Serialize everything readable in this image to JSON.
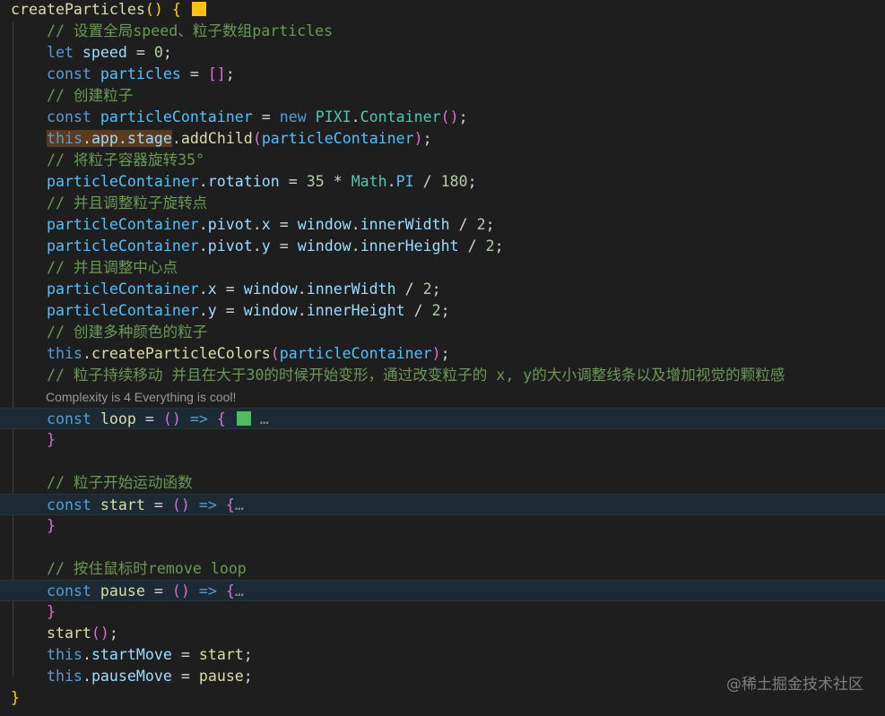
{
  "codelens": {
    "text": "Complexity is 4 Everything is cool!"
  },
  "watermark": "@稀土掘金技术社区",
  "colors": {
    "swatch_yellow": "#ffc20e",
    "swatch_green": "#4dbb5f"
  },
  "lines": [
    [
      {
        "t": "createParticles",
        "c": "fn"
      },
      {
        "t": "() ",
        "c": "br1"
      },
      {
        "t": "{",
        "c": "br1"
      },
      {
        "t": " ",
        "c": "plain"
      },
      {
        "t": "",
        "c": "swatch",
        "color": "swatch_yellow"
      }
    ],
    [
      {
        "t": "    // 设置全局speed、粒子数组particles",
        "c": "cmt"
      }
    ],
    [
      {
        "t": "    let",
        "c": "kw"
      },
      {
        "t": " speed",
        "c": "var"
      },
      {
        "t": " = ",
        "c": "op"
      },
      {
        "t": "0",
        "c": "num"
      },
      {
        "t": ";",
        "c": "op"
      }
    ],
    [
      {
        "t": "    const",
        "c": "kw"
      },
      {
        "t": " particles",
        "c": "cst"
      },
      {
        "t": " = ",
        "c": "op"
      },
      {
        "t": "[]",
        "c": "br2"
      },
      {
        "t": ";",
        "c": "op"
      }
    ],
    [
      {
        "t": "    // 创建粒子",
        "c": "cmt"
      }
    ],
    [
      {
        "t": "    const",
        "c": "kw"
      },
      {
        "t": " particleContainer",
        "c": "cst"
      },
      {
        "t": " = ",
        "c": "op"
      },
      {
        "t": "new",
        "c": "kw"
      },
      {
        "t": " PIXI",
        "c": "cls"
      },
      {
        "t": ".",
        "c": "op"
      },
      {
        "t": "Container",
        "c": "cls"
      },
      {
        "t": "()",
        "c": "br2"
      },
      {
        "t": ";",
        "c": "op"
      }
    ],
    [
      {
        "t": "    ",
        "c": "plain"
      },
      {
        "t": "this",
        "c": "kw",
        "hl": true
      },
      {
        "t": ".",
        "c": "op",
        "hl": true
      },
      {
        "t": "app",
        "c": "var",
        "hl": true
      },
      {
        "t": ".",
        "c": "op",
        "hl": true
      },
      {
        "t": "stage",
        "c": "var",
        "hl": true
      },
      {
        "t": ".",
        "c": "op"
      },
      {
        "t": "addChild",
        "c": "fn"
      },
      {
        "t": "(",
        "c": "br2"
      },
      {
        "t": "particleContainer",
        "c": "cst"
      },
      {
        "t": ")",
        "c": "br2"
      },
      {
        "t": ";",
        "c": "op"
      }
    ],
    [
      {
        "t": "    // 将粒子容器旋转35°",
        "c": "cmt"
      }
    ],
    [
      {
        "t": "    particleContainer",
        "c": "cst"
      },
      {
        "t": ".",
        "c": "op"
      },
      {
        "t": "rotation",
        "c": "var"
      },
      {
        "t": " = ",
        "c": "op"
      },
      {
        "t": "35",
        "c": "num"
      },
      {
        "t": " * ",
        "c": "op"
      },
      {
        "t": "Math",
        "c": "cls"
      },
      {
        "t": ".",
        "c": "op"
      },
      {
        "t": "PI",
        "c": "cst"
      },
      {
        "t": " / ",
        "c": "op"
      },
      {
        "t": "180",
        "c": "num"
      },
      {
        "t": ";",
        "c": "op"
      }
    ],
    [
      {
        "t": "    // 并且调整粒子旋转点",
        "c": "cmt"
      }
    ],
    [
      {
        "t": "    particleContainer",
        "c": "cst"
      },
      {
        "t": ".",
        "c": "op"
      },
      {
        "t": "pivot",
        "c": "var"
      },
      {
        "t": ".",
        "c": "op"
      },
      {
        "t": "x",
        "c": "var"
      },
      {
        "t": " = ",
        "c": "op"
      },
      {
        "t": "window",
        "c": "var"
      },
      {
        "t": ".",
        "c": "op"
      },
      {
        "t": "innerWidth",
        "c": "var"
      },
      {
        "t": " / ",
        "c": "op"
      },
      {
        "t": "2",
        "c": "num"
      },
      {
        "t": ";",
        "c": "op"
      }
    ],
    [
      {
        "t": "    particleContainer",
        "c": "cst"
      },
      {
        "t": ".",
        "c": "op"
      },
      {
        "t": "pivot",
        "c": "var"
      },
      {
        "t": ".",
        "c": "op"
      },
      {
        "t": "y",
        "c": "var"
      },
      {
        "t": " = ",
        "c": "op"
      },
      {
        "t": "window",
        "c": "var"
      },
      {
        "t": ".",
        "c": "op"
      },
      {
        "t": "innerHeight",
        "c": "var"
      },
      {
        "t": " / ",
        "c": "op"
      },
      {
        "t": "2",
        "c": "num"
      },
      {
        "t": ";",
        "c": "op"
      }
    ],
    [
      {
        "t": "    // 并且调整中心点",
        "c": "cmt"
      }
    ],
    [
      {
        "t": "    particleContainer",
        "c": "cst"
      },
      {
        "t": ".",
        "c": "op"
      },
      {
        "t": "x",
        "c": "var"
      },
      {
        "t": " = ",
        "c": "op"
      },
      {
        "t": "window",
        "c": "var"
      },
      {
        "t": ".",
        "c": "op"
      },
      {
        "t": "innerWidth",
        "c": "var"
      },
      {
        "t": " / ",
        "c": "op"
      },
      {
        "t": "2",
        "c": "num"
      },
      {
        "t": ";",
        "c": "op"
      }
    ],
    [
      {
        "t": "    particleContainer",
        "c": "cst"
      },
      {
        "t": ".",
        "c": "op"
      },
      {
        "t": "y",
        "c": "var"
      },
      {
        "t": " = ",
        "c": "op"
      },
      {
        "t": "window",
        "c": "var"
      },
      {
        "t": ".",
        "c": "op"
      },
      {
        "t": "innerHeight",
        "c": "var"
      },
      {
        "t": " / ",
        "c": "op"
      },
      {
        "t": "2",
        "c": "num"
      },
      {
        "t": ";",
        "c": "op"
      }
    ],
    [
      {
        "t": "    // 创建多种颜色的粒子",
        "c": "cmt"
      }
    ],
    [
      {
        "t": "    this",
        "c": "kw"
      },
      {
        "t": ".",
        "c": "op"
      },
      {
        "t": "createParticleColors",
        "c": "fn"
      },
      {
        "t": "(",
        "c": "br2"
      },
      {
        "t": "particleContainer",
        "c": "cst"
      },
      {
        "t": ")",
        "c": "br2"
      },
      {
        "t": ";",
        "c": "op"
      }
    ],
    [
      {
        "t": "    // 粒子持续移动 并且在大于30的时候开始变形，通过改变粒子的 x, y的大小调整线条以及增加视觉的颗粒感",
        "c": "cmt"
      }
    ],
    [],
    [
      {
        "t": "    const",
        "c": "kw"
      },
      {
        "t": " loop",
        "c": "fn"
      },
      {
        "t": " = ",
        "c": "op"
      },
      {
        "t": "()",
        "c": "br2"
      },
      {
        "t": " => ",
        "c": "kw"
      },
      {
        "t": "{",
        "c": "br2"
      },
      {
        "t": " ",
        "c": "plain"
      },
      {
        "t": "",
        "c": "swatch",
        "color": "swatch_green"
      },
      {
        "t": " …",
        "c": "dots"
      }
    ],
    [
      {
        "t": "    }",
        "c": "br2"
      }
    ],
    [],
    [
      {
        "t": "    // 粒子开始运动函数",
        "c": "cmt"
      }
    ],
    [
      {
        "t": "    const",
        "c": "kw"
      },
      {
        "t": " start",
        "c": "fn"
      },
      {
        "t": " = ",
        "c": "op"
      },
      {
        "t": "()",
        "c": "br2"
      },
      {
        "t": " => ",
        "c": "kw"
      },
      {
        "t": "{",
        "c": "br2"
      },
      {
        "t": "…",
        "c": "dots"
      }
    ],
    [
      {
        "t": "    }",
        "c": "br2"
      }
    ],
    [],
    [
      {
        "t": "    // 按住鼠标时remove loop",
        "c": "cmt"
      }
    ],
    [
      {
        "t": "    const",
        "c": "kw"
      },
      {
        "t": " pause",
        "c": "fn"
      },
      {
        "t": " = ",
        "c": "op"
      },
      {
        "t": "()",
        "c": "br2"
      },
      {
        "t": " => ",
        "c": "kw"
      },
      {
        "t": "{",
        "c": "br2"
      },
      {
        "t": "…",
        "c": "dots"
      }
    ],
    [
      {
        "t": "    }",
        "c": "br2"
      }
    ],
    [
      {
        "t": "    start",
        "c": "fn"
      },
      {
        "t": "()",
        "c": "br2"
      },
      {
        "t": ";",
        "c": "op"
      }
    ],
    [
      {
        "t": "    this",
        "c": "kw"
      },
      {
        "t": ".",
        "c": "op"
      },
      {
        "t": "startMove",
        "c": "var"
      },
      {
        "t": " = ",
        "c": "op"
      },
      {
        "t": "start",
        "c": "fn"
      },
      {
        "t": ";",
        "c": "op"
      }
    ],
    [
      {
        "t": "    this",
        "c": "kw"
      },
      {
        "t": ".",
        "c": "op"
      },
      {
        "t": "pauseMove",
        "c": "var"
      },
      {
        "t": " = ",
        "c": "op"
      },
      {
        "t": "pause",
        "c": "fn"
      },
      {
        "t": ";",
        "c": "op"
      }
    ],
    [
      {
        "t": "}",
        "c": "br1"
      }
    ]
  ]
}
